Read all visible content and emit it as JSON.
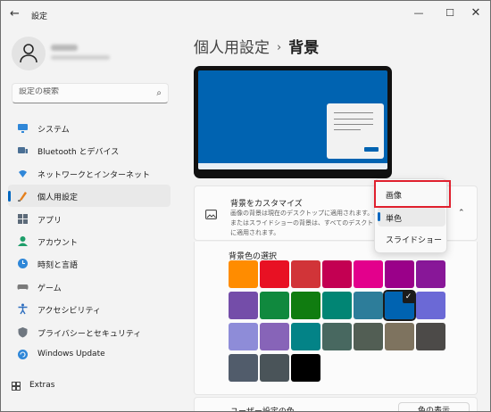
{
  "window": {
    "app_title": "設定",
    "back_glyph": "←",
    "min_glyph": "—",
    "max_glyph": "☐",
    "close_glyph": "✕"
  },
  "search": {
    "placeholder": "設定の検索",
    "icon": "search-icon"
  },
  "nav": {
    "items": [
      {
        "label": "システム",
        "icon": "monitor-icon",
        "color": "#2f87d8"
      },
      {
        "label": "Bluetooth とデバイス",
        "icon": "bluetooth-devices-icon",
        "color": "#4a6f94"
      },
      {
        "label": "ネットワークとインターネット",
        "icon": "wifi-icon",
        "color": "#2f87d8"
      },
      {
        "label": "個人用設定",
        "icon": "pen-icon",
        "color": "#e57f1b",
        "active": true
      },
      {
        "label": "アプリ",
        "icon": "apps-icon",
        "color": "#5c6a79"
      },
      {
        "label": "アカウント",
        "icon": "person-icon",
        "color": "#1e9e6a"
      },
      {
        "label": "時刻と言語",
        "icon": "globe-clock-icon",
        "color": "#2f87d8"
      },
      {
        "label": "ゲーム",
        "icon": "gamepad-icon",
        "color": "#7a7a7a"
      },
      {
        "label": "アクセシビリティ",
        "icon": "accessibility-icon",
        "color": "#2f6fbf"
      },
      {
        "label": "プライバシーとセキュリティ",
        "icon": "shield-icon",
        "color": "#6f7780"
      },
      {
        "label": "Windows Update",
        "icon": "update-icon",
        "color": "#2f87d8"
      }
    ],
    "extras_label": "Extras"
  },
  "main": {
    "breadcrumb_parent": "個人用設定",
    "breadcrumb_sep": "›",
    "breadcrumb_current": "背景",
    "card": {
      "title": "背景をカスタマイズ",
      "description": "画像の背景は現在のデスクトップに適用されます。単色またはスライドショーの背景は、すべてのデスクトップに適用されます。",
      "chevron": "⌃"
    },
    "colors_title": "背景色の選択",
    "swatches": [
      [
        "#ff8c00",
        "#e81123",
        "#d13438",
        "#c30052",
        "#e3008c",
        "#9a0089",
        "#881798"
      ],
      [
        "#744da9",
        "#10893e",
        "#107c10",
        "#018574",
        "#2d7d9a",
        "#0063b1",
        "#6b69d6"
      ],
      [
        "#8e8cd8",
        "#8764b8",
        "#038387",
        "#486860",
        "#525e54",
        "#7e735f",
        "#4c4a48"
      ],
      [
        "#515c6b",
        "#4a5459",
        "#000000"
      ]
    ],
    "selected_swatch": "#0063b1",
    "check_glyph": "✓",
    "bottom_label": "ユーザー設定の色",
    "bottom_button": "色の表示"
  },
  "dropdown": {
    "options": [
      "画像",
      "単色",
      "スライドショー"
    ],
    "selected": "単色"
  },
  "accent": "#0067c0",
  "highlight_color": "#e0202e"
}
